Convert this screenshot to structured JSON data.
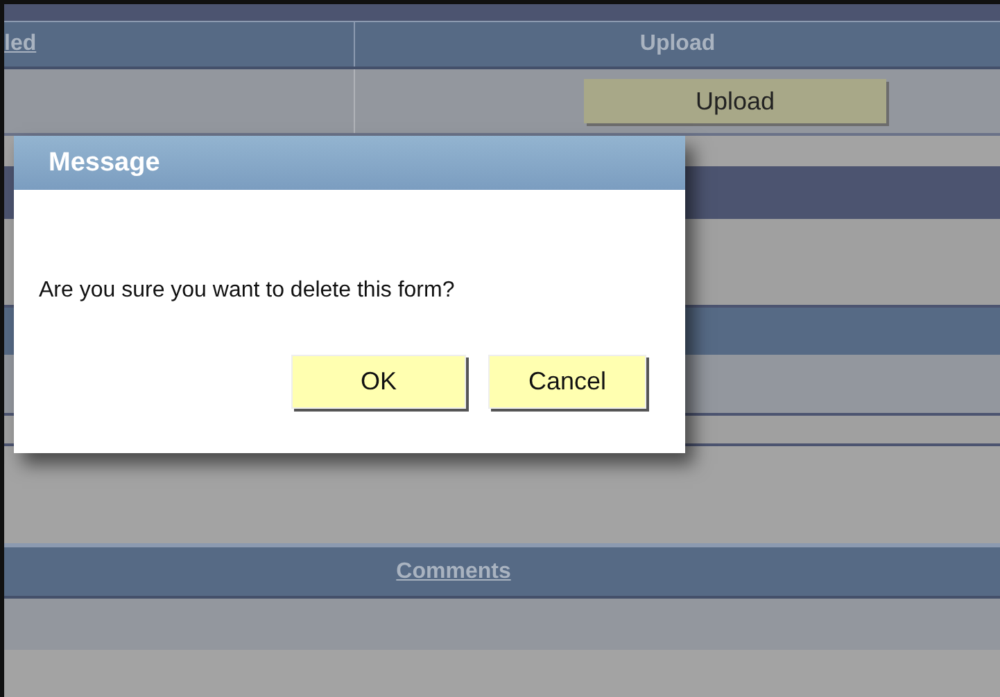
{
  "table": {
    "columns": [
      {
        "label": "led",
        "kind": "link"
      },
      {
        "label": "Upload",
        "kind": "plain"
      }
    ],
    "upload_button": "Upload"
  },
  "comments_header": "Comments",
  "dialog": {
    "title": "Message",
    "message": "Are you sure you want to delete this form?",
    "buttons": [
      "OK",
      "Cancel"
    ]
  }
}
